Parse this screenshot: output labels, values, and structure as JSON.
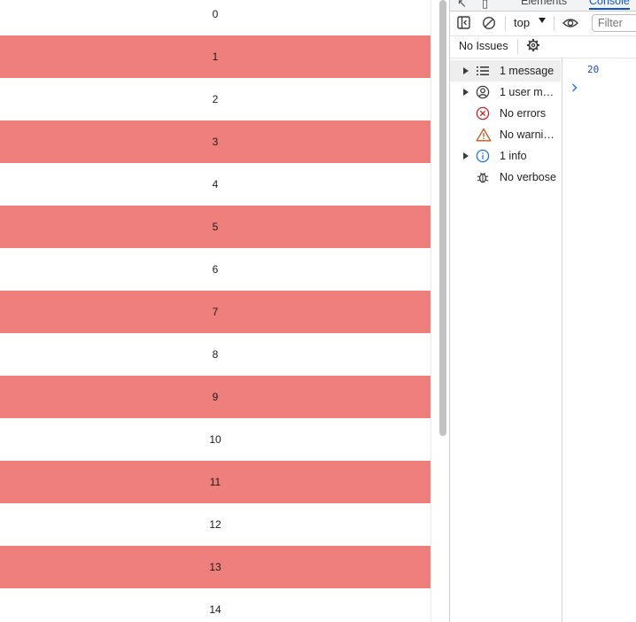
{
  "page": {
    "rows": [
      "0",
      "1",
      "2",
      "3",
      "4",
      "5",
      "6",
      "7",
      "8",
      "9",
      "10",
      "11",
      "12",
      "13",
      "14"
    ]
  },
  "devtools": {
    "tabs": [
      "Elements",
      "Console"
    ],
    "toolbar": {
      "context": "top",
      "filter_placeholder": "Filter"
    },
    "issues_label": "No Issues",
    "sidebar": [
      {
        "label": "1 message",
        "icon": "list-icon",
        "expandable": true,
        "selected": true
      },
      {
        "label": "1 user me…",
        "icon": "user-icon",
        "expandable": true,
        "selected": false
      },
      {
        "label": "No errors",
        "icon": "error-icon",
        "expandable": false,
        "selected": false
      },
      {
        "label": "No warnin…",
        "icon": "warning-icon",
        "expandable": false,
        "selected": false
      },
      {
        "label": "1 info",
        "icon": "info-icon",
        "expandable": true,
        "selected": false
      },
      {
        "label": "No verbose",
        "icon": "bug-icon",
        "expandable": false,
        "selected": false
      }
    ],
    "console": {
      "log_value": "20"
    }
  },
  "colors": {
    "odd_row": "#ef7f7d",
    "accent": "#0b57d0",
    "log_value": "#1a4ab3",
    "error": "#c5221f",
    "warning": "#c0581b",
    "info": "#1a73e8"
  }
}
